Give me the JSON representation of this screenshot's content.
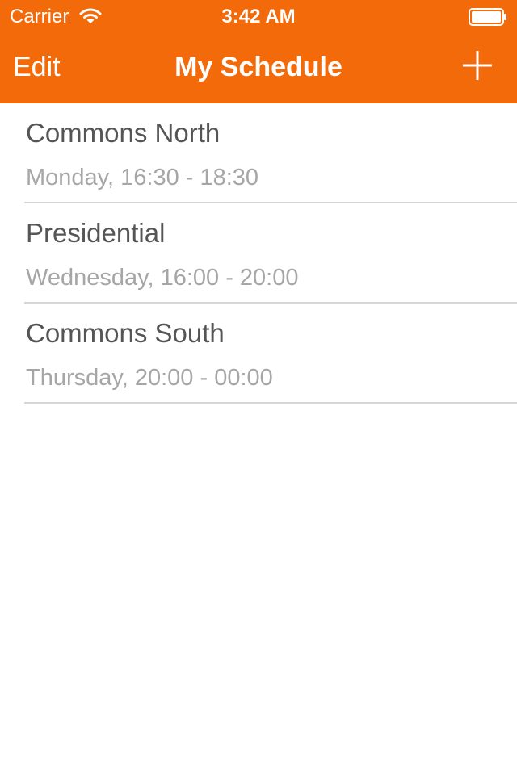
{
  "status_bar": {
    "carrier": "Carrier",
    "time": "3:42 AM",
    "wifi_icon": "wifi-icon",
    "battery_icon": "battery-icon"
  },
  "nav": {
    "edit_label": "Edit",
    "title": "My Schedule",
    "add_icon": "plus-icon",
    "color": "#f36a0b"
  },
  "schedule": [
    {
      "name": "Commons North",
      "when": "Monday, 16:30 - 18:30"
    },
    {
      "name": "Presidential",
      "when": "Wednesday, 16:00 - 20:00"
    },
    {
      "name": "Commons South",
      "when": "Thursday, 20:00 - 00:00"
    }
  ]
}
